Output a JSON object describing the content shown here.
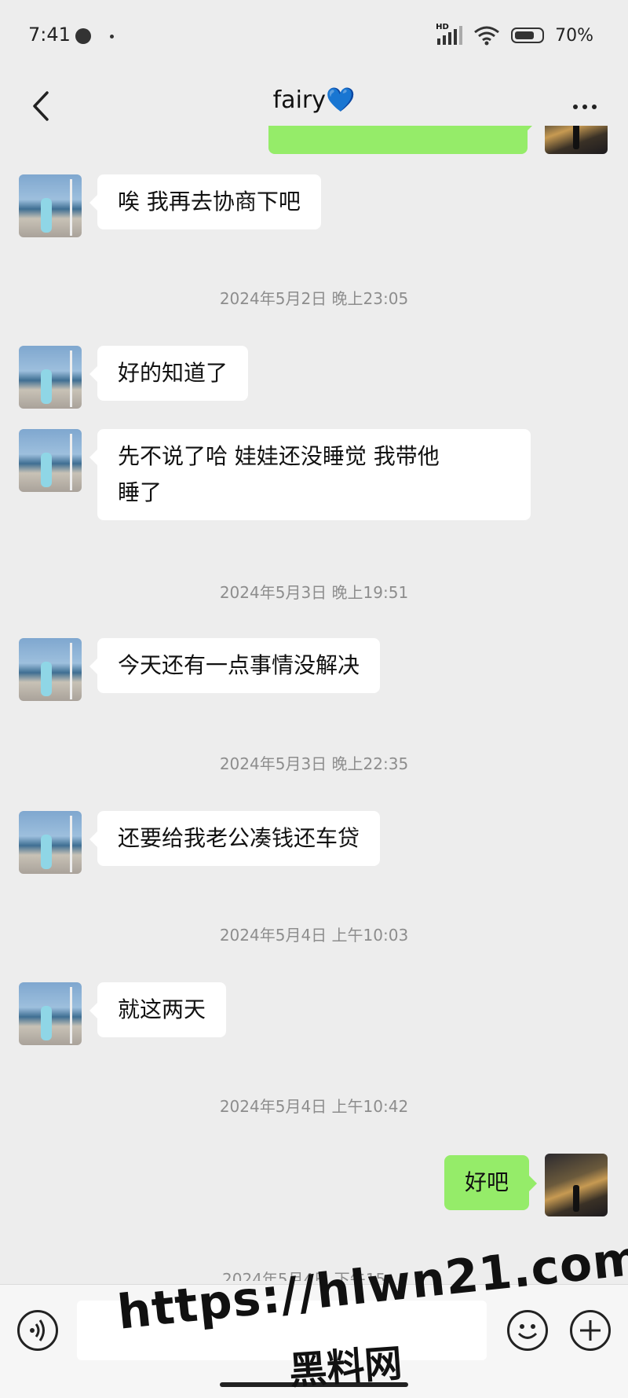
{
  "status_bar": {
    "time": "7:41",
    "battery": "70%"
  },
  "header": {
    "title": "fairy",
    "title_emoji": "💙"
  },
  "messages": [
    {
      "side": "left",
      "lines": [
        "唉 我再去协商下吧"
      ]
    },
    {
      "timestamp": "2024年5月2日 晚上23:05"
    },
    {
      "side": "left",
      "lines": [
        "好的知道了"
      ]
    },
    {
      "side": "left",
      "lines": [
        "先不说了哈 娃娃还没睡觉 我带他",
        "睡了"
      ]
    },
    {
      "timestamp": "2024年5月3日 晚上19:51"
    },
    {
      "side": "left",
      "lines": [
        "今天还有一点事情没解决"
      ]
    },
    {
      "timestamp": "2024年5月3日 晚上22:35"
    },
    {
      "side": "left",
      "lines": [
        "还要给我老公凑钱还车贷"
      ]
    },
    {
      "timestamp": "2024年5月4日 上午10:03"
    },
    {
      "side": "left",
      "lines": [
        "就这两天"
      ]
    },
    {
      "timestamp": "2024年5月4日 上午10:42"
    },
    {
      "side": "right",
      "lines": [
        "好吧"
      ]
    },
    {
      "timestamp": "2024年5月4日 下午15:..."
    }
  ],
  "watermark": {
    "url": "https://hlwn21.com",
    "name": "黑料网"
  },
  "colors": {
    "background": "#ededed",
    "self_bubble": "#95ec69",
    "other_bubble": "#ffffff"
  },
  "icons": [
    "back-icon",
    "more-icon",
    "voice-icon",
    "emoji-icon",
    "add-icon"
  ]
}
